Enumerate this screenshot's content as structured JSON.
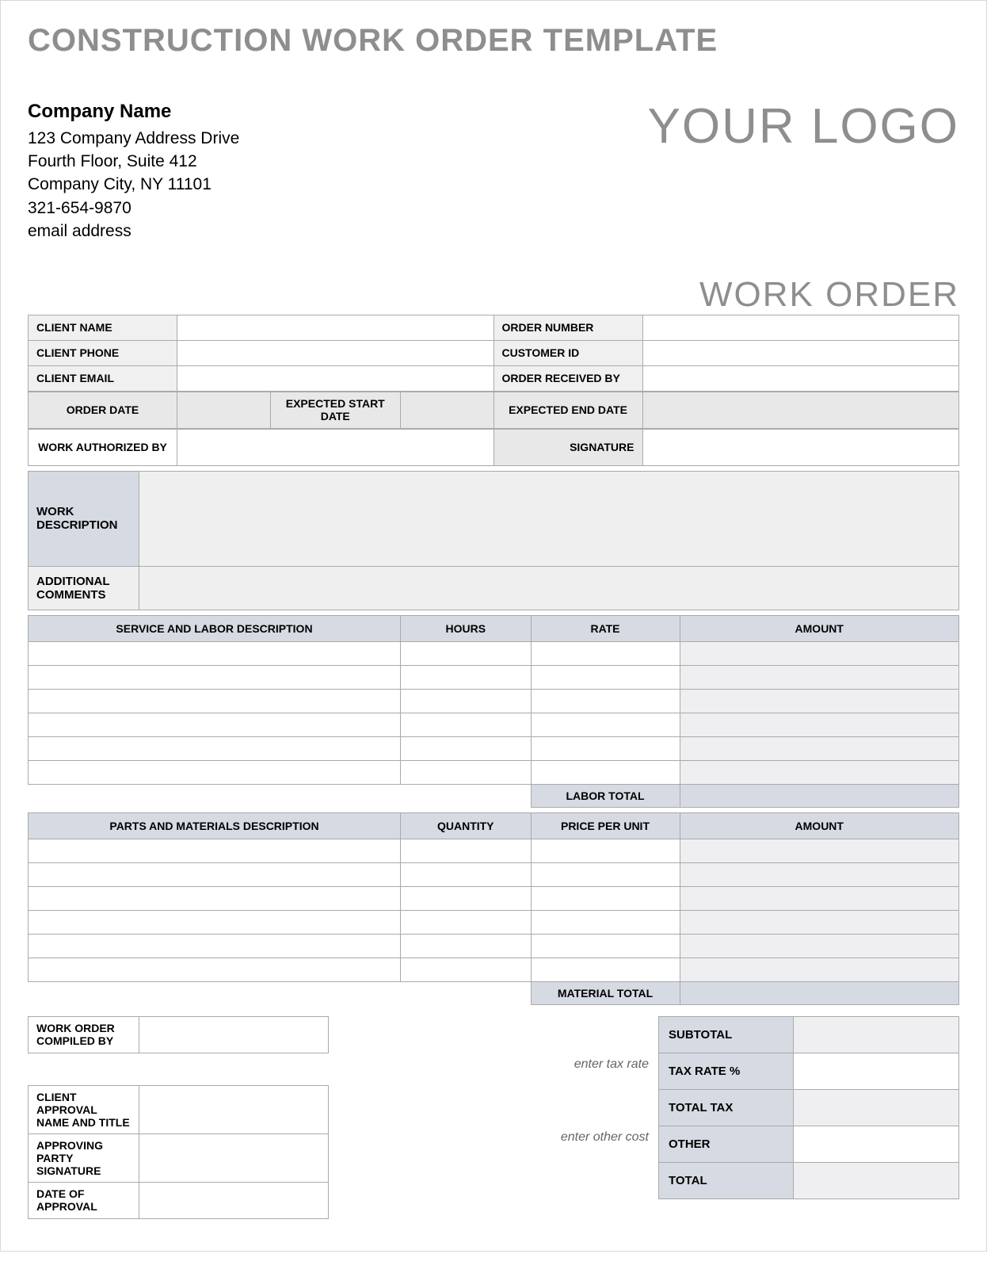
{
  "title": "CONSTRUCTION WORK ORDER TEMPLATE",
  "company": {
    "name": "Company Name",
    "address1": "123 Company Address Drive",
    "address2": "Fourth Floor, Suite 412",
    "citystate": "Company City, NY  11101",
    "phone": "321-654-9870",
    "email": "email address"
  },
  "logo_text": "YOUR LOGO",
  "workorder_heading": "WORK ORDER",
  "labels": {
    "client_name": "CLIENT NAME",
    "client_phone": "CLIENT PHONE",
    "client_email": "CLIENT EMAIL",
    "order_number": "ORDER NUMBER",
    "customer_id": "CUSTOMER ID",
    "order_received_by": "ORDER RECEIVED BY",
    "order_date": "ORDER DATE",
    "expected_start": "EXPECTED START DATE",
    "expected_end": "EXPECTED END DATE",
    "work_authorized_by": "WORK AUTHORIZED BY",
    "signature": "SIGNATURE",
    "work_description": "WORK DESCRIPTION",
    "additional_comments": "ADDITIONAL COMMENTS",
    "service_desc": "SERVICE AND LABOR DESCRIPTION",
    "hours": "HOURS",
    "rate": "RATE",
    "amount": "AMOUNT",
    "labor_total": "LABOR TOTAL",
    "parts_desc": "PARTS AND MATERIALS DESCRIPTION",
    "quantity": "QUANTITY",
    "price_per_unit": "PRICE PER UNIT",
    "material_total": "MATERIAL TOTAL",
    "compiled_by": "WORK ORDER COMPILED BY",
    "client_approval": "CLIENT APPROVAL NAME AND TITLE",
    "approving_party_sig": "APPROVING PARTY SIGNATURE",
    "date_of_approval": "DATE OF APPROVAL",
    "subtotal": "SUBTOTAL",
    "tax_rate": "TAX RATE %",
    "total_tax": "TOTAL TAX",
    "other": "OTHER",
    "total": "TOTAL",
    "enter_tax_rate": "enter tax rate",
    "enter_other_cost": "enter other cost"
  }
}
